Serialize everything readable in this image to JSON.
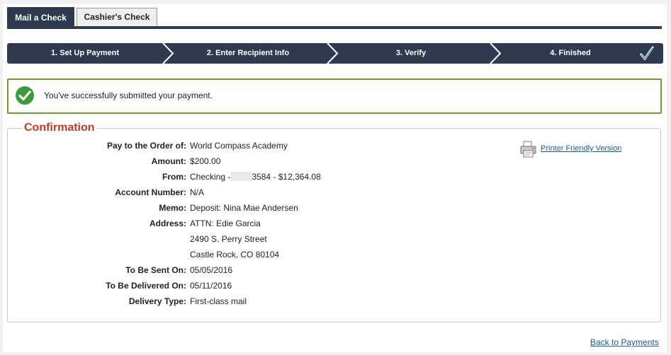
{
  "tabs": {
    "active": "Mail a Check",
    "inactive": "Cashier's Check"
  },
  "steps": [
    {
      "label": "1. Set Up Payment"
    },
    {
      "label": "2. Enter Recipient Info"
    },
    {
      "label": "3. Verify"
    },
    {
      "label": "4. Finished"
    }
  ],
  "success": {
    "message": "You've successfully submitted your payment."
  },
  "confirmation": {
    "title": "Confirmation",
    "printer_link": "Printer Friendly Version",
    "fields": {
      "pay_to": {
        "label": "Pay to the Order of:",
        "value": "World Compass Academy"
      },
      "amount": {
        "label": "Amount:",
        "value": "$200.00"
      },
      "from": {
        "label": "From:",
        "value_prefix": "Checking -",
        "value_suffix": "3584 - $12,364.08"
      },
      "account_number": {
        "label": "Account Number:",
        "value": "N/A"
      },
      "memo": {
        "label": "Memo:",
        "value": "Deposit: Nina Mae Andersen"
      },
      "address": {
        "label": "Address:",
        "line1": "ATTN: Edie Garcia",
        "line2": "2490 S. Perry Street",
        "line3": "Castle Rock, CO 80104"
      },
      "sent_on": {
        "label": "To Be Sent On:",
        "value": "05/05/2016"
      },
      "delivered_on": {
        "label": "To Be Delivered On:",
        "value": "05/11/2016"
      },
      "delivery_type": {
        "label": "Delivery Type:",
        "value": "First-class mail"
      }
    }
  },
  "footer": {
    "back_link": "Back to Payments"
  },
  "colors": {
    "navy": "#2d3a4f",
    "success_green": "#6a9a2c",
    "title_red": "#c23a26",
    "link_blue": "#1a5a9a"
  }
}
